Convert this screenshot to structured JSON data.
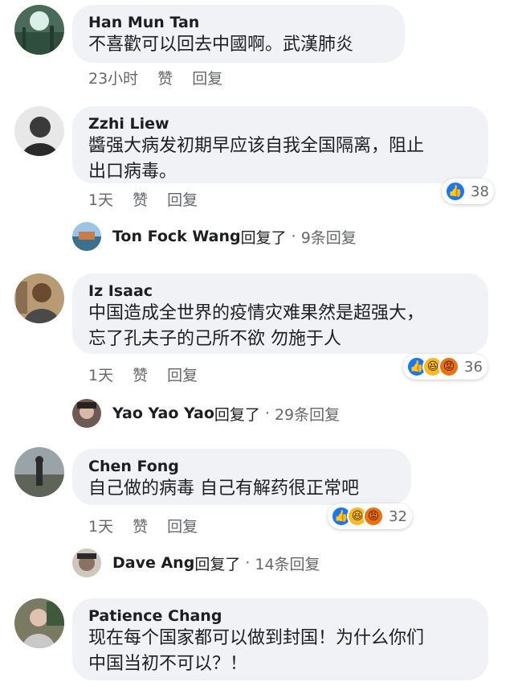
{
  "comments": [
    {
      "author": "Han Mun Tan",
      "lines": [
        "不喜歡可以回去中國啊。武漢肺炎"
      ],
      "time": "23小时",
      "like_label": "赞",
      "reply_label": "回复"
    },
    {
      "author": "Zzhi Liew",
      "lines": [
        "醬强大病发初期早应该自我全国隔离，阻止",
        "出口病毒。"
      ],
      "time": "1天",
      "like_label": "赞",
      "reply_label": "回复",
      "reaction_count": "38",
      "reply": {
        "name": "Ton Fock Wang",
        "verb": "回复了",
        "count": "9条回复"
      }
    },
    {
      "author": "Iz Isaac",
      "lines": [
        "中国造成全世界的疫情灾难果然是超强大，",
        "忘了孔夫子的己所不欲 勿施于人"
      ],
      "time": "1天",
      "like_label": "赞",
      "reply_label": "回复",
      "reaction_count": "36",
      "reply": {
        "name": "Yao Yao Yao",
        "verb": "回复了",
        "count": "29条回复"
      }
    },
    {
      "author": "Chen Fong",
      "lines": [
        "自己做的病毒 自己有解药很正常吧"
      ],
      "time": "1天",
      "like_label": "赞",
      "reply_label": "回复",
      "reaction_count": "32",
      "reply": {
        "name": "Dave Ang",
        "verb": "回复了",
        "count": "14条回复"
      }
    },
    {
      "author": "Patience Chang",
      "lines": [
        "现在每个国家都可以做到封国！为什么你们",
        "中国当初不可以？！"
      ]
    }
  ],
  "separator": "·",
  "colors": {
    "bubble": "#f0f2f5",
    "like": "#1877f2",
    "haha": "#f7b928",
    "angry": "#e9710f",
    "meta": "#65676b"
  },
  "icons": {
    "like": "thumbs-up-icon",
    "haha": "laughing-face-icon",
    "angry": "angry-face-icon",
    "reply": "reply-arrow-icon"
  }
}
